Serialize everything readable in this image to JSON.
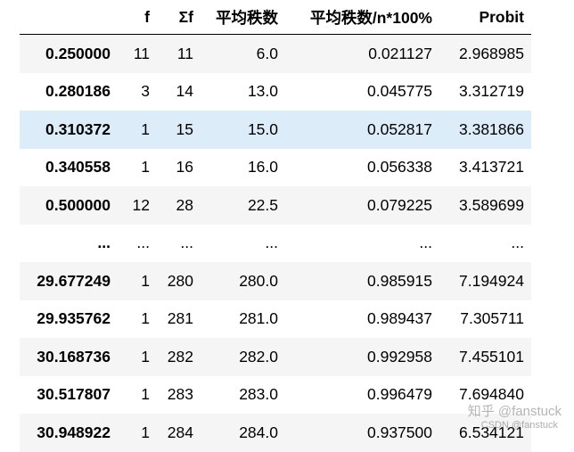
{
  "columns": [
    "",
    "f",
    "Σf",
    "平均秩数",
    "平均秩数/n*100%",
    "Probit"
  ],
  "rows": [
    [
      "0.250000",
      "11",
      "11",
      "6.0",
      "0.021127",
      "2.968985"
    ],
    [
      "0.280186",
      "3",
      "14",
      "13.0",
      "0.045775",
      "3.312719"
    ],
    [
      "0.310372",
      "1",
      "15",
      "15.0",
      "0.052817",
      "3.381866"
    ],
    [
      "0.340558",
      "1",
      "16",
      "16.0",
      "0.056338",
      "3.413721"
    ],
    [
      "0.500000",
      "12",
      "28",
      "22.5",
      "0.079225",
      "3.589699"
    ],
    [
      "...",
      "...",
      "...",
      "...",
      "...",
      "..."
    ],
    [
      "29.677249",
      "1",
      "280",
      "280.0",
      "0.985915",
      "7.194924"
    ],
    [
      "29.935762",
      "1",
      "281",
      "281.0",
      "0.989437",
      "7.305711"
    ],
    [
      "30.168736",
      "1",
      "282",
      "282.0",
      "0.992958",
      "7.455101"
    ],
    [
      "30.517807",
      "1",
      "283",
      "283.0",
      "0.996479",
      "7.694840"
    ],
    [
      "30.948922",
      "1",
      "284",
      "284.0",
      "0.937500",
      "6.534121"
    ]
  ],
  "watermark": {
    "main": "知乎 @fanstuck",
    "sub": "CSDN @fanstuck"
  },
  "colors": {
    "row_stripe": "#f5f5f5",
    "row_hover": "#dcecf9"
  }
}
